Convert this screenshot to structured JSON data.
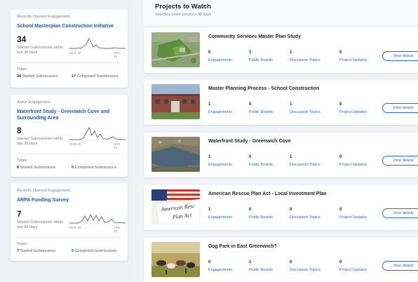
{
  "cards": [
    {
      "kicker": "Recently Opened Engagement:",
      "title": "School Masterplan Construction Initiative",
      "count": "34",
      "count_label": "Started Submissions within last 30 days",
      "tick_start": "MAR 20",
      "tick_end": "APR 18",
      "totals_label": "Totals",
      "started_num": "34",
      "started_label": "Started Submissions",
      "completed_num": "17",
      "completed_label": "Completed Submissions"
    },
    {
      "kicker": "Active Engagement:",
      "title": "Waterfront Study - Greenwich Cove and Surrounding Area",
      "count": "8",
      "count_label": "Started Submissions within last 30 days",
      "tick_start": "MAR 20",
      "tick_end": "APR 18",
      "totals_label": "Totals",
      "started_num": "8",
      "started_label": "Started Submissions",
      "completed_num": "8",
      "completed_label": "Completed Submissions"
    },
    {
      "kicker": "Recently Opened Engagement:",
      "title": "ARPA Funding Survey",
      "count": "7",
      "count_label": "Started Submissions within last 30 days",
      "tick_start": "MAR 20",
      "tick_end": "APR 18",
      "totals_label": "Totals",
      "started_num": "7",
      "started_label": "Started Submissions",
      "completed_num": "5",
      "completed_label": "Completed Submissions"
    }
  ],
  "main": {
    "title": "Projects to Watch",
    "subtitle": "Statistics cover previous 30 days"
  },
  "stat_labels": [
    "Engagements",
    "Public Boards",
    "Discussion Topics",
    "Project Updates"
  ],
  "view_label": "View details",
  "projects": [
    {
      "title": "Community Services Master Plan Study",
      "stats": [
        "0",
        "1",
        "1",
        "0"
      ]
    },
    {
      "title": "Master Planning Process - School Construction",
      "stats": [
        "1",
        "0",
        "1",
        "0"
      ]
    },
    {
      "title": "Waterfront Study - Greenwich Cove",
      "stats": [
        "1",
        "0",
        "1",
        "0"
      ]
    },
    {
      "title": "American Rescue Plan Act - Local Investment Plan",
      "stats": [
        "1",
        "0",
        "0",
        "0"
      ]
    },
    {
      "title": "Dog Park in East Greenwich?",
      "stats": [
        "0",
        "1",
        "0",
        "0"
      ]
    }
  ],
  "thumb_texts": {
    "arpa_line1": "American Resc",
    "arpa_line2": "Plan Act"
  },
  "colors": {
    "accent": "#1f57c3",
    "link": "#2e6ad4"
  }
}
